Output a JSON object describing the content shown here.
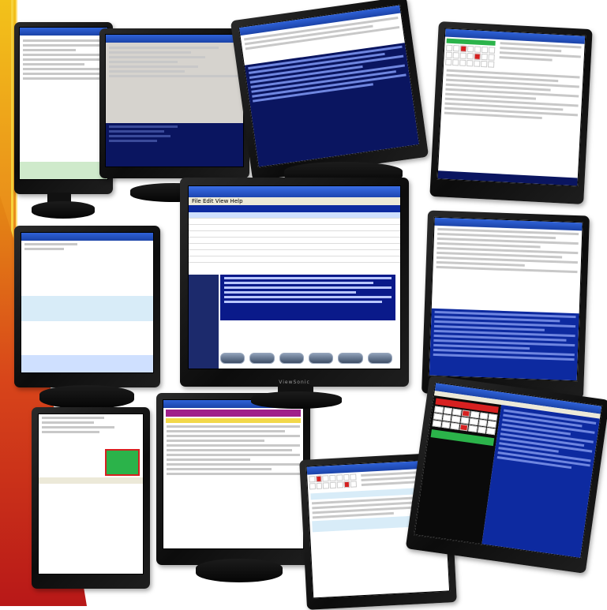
{
  "scene": {
    "description_colors": {
      "accent_red": "#b81818",
      "accent_orange": "#e58a14",
      "screen_blue": "#0d2aa0"
    }
  },
  "center_window": {
    "menu": "File  Edit  View  Help"
  },
  "monitor_brand": "ViewSonic"
}
